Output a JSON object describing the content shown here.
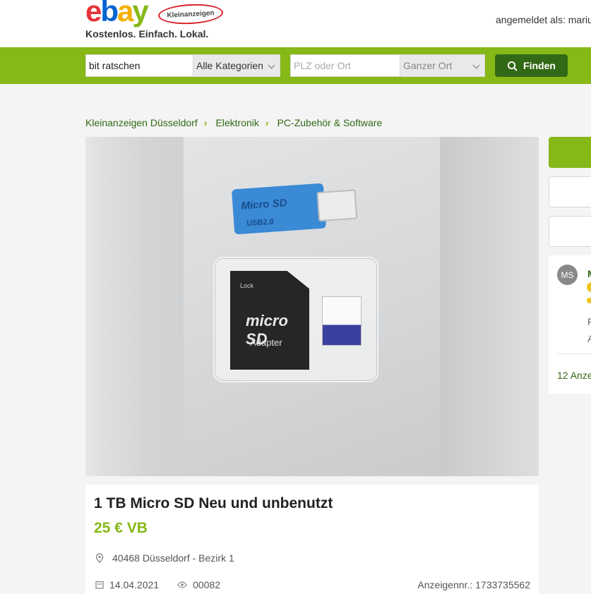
{
  "header": {
    "logo_letters": [
      "e",
      "b",
      "a",
      "y"
    ],
    "logo_badge": "Kleinanzeigen",
    "tagline": "Kostenlos. Einfach. Lokal.",
    "user_label": "angemeldet als: mariu"
  },
  "search": {
    "query_value": "bit ratschen",
    "category_value": "Alle Kategorien",
    "location_placeholder": "PLZ oder Ort",
    "radius_value": "Ganzer Ort",
    "find_label": "Finden"
  },
  "breadcrumbs": [
    "Kleinanzeigen Düsseldorf",
    "Elektronik",
    "PC-Zubehör & Software"
  ],
  "gallery": {
    "reader_brand": "Micro SD",
    "reader_sub": "USB2.0",
    "adapter_lock": "Lock",
    "adapter_brand": "micro SD",
    "adapter_label": "Adapter"
  },
  "sidebar": {
    "avatar_initials": "MS",
    "name_fragment": "M",
    "line1_fragment": "F",
    "line2_fragment": "A",
    "more_link": "12 Anze"
  },
  "listing": {
    "title": "1 TB Micro SD Neu und unbenutzt",
    "price": "25 € VB",
    "location": "40468 Düsseldorf - Bezirk 1",
    "date": "14.04.2021",
    "views": "00082",
    "ad_number": "Anzeigennr.: 1733735562"
  },
  "colors": {
    "brand_green": "#86b817",
    "dark_green": "#326916"
  },
  "icons": {
    "search": "search-icon",
    "location": "location-pin-icon",
    "date": "calendar-icon",
    "views": "eye-icon",
    "breadcrumb_separator": "chevron-right-icon",
    "select": "chevron-down-icon"
  }
}
